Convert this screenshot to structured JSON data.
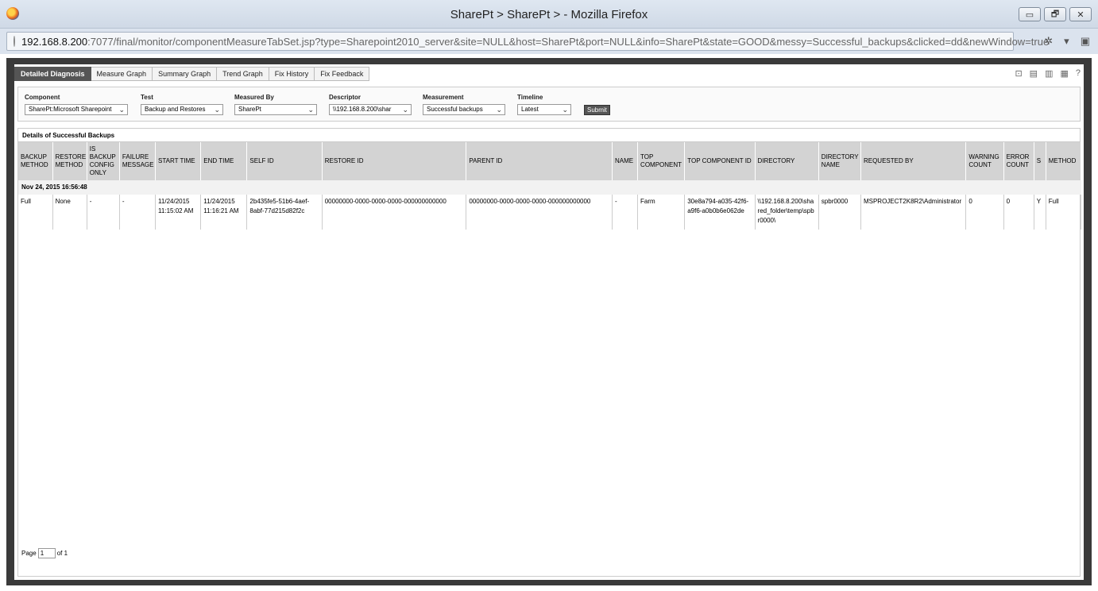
{
  "window": {
    "title": "SharePt > SharePt > - Mozilla Firefox",
    "btn_min": "▭",
    "btn_max": "🗗",
    "btn_close": "✕"
  },
  "url": {
    "host": "192.168.8.200",
    "path": ":7077/final/monitor/componentMeasureTabSet.jsp?type=Sharepoint2010_server&site=NULL&host=SharePt&port=NULL&info=SharePt&state=GOOD&messy=Successful_backups&clicked=dd&newWindow=true"
  },
  "tabs": [
    "Detailed Diagnosis",
    "Measure Graph",
    "Summary Graph",
    "Trend Graph",
    "Fix History",
    "Fix Feedback"
  ],
  "filters": {
    "component": {
      "label": "Component",
      "value": "SharePt:Microsoft Sharepoint"
    },
    "test": {
      "label": "Test",
      "value": "Backup and Restores"
    },
    "measured_by": {
      "label": "Measured By",
      "value": "SharePt"
    },
    "descriptor": {
      "label": "Descriptor",
      "value": "\\\\192.168.8.200\\shar"
    },
    "measurement": {
      "label": "Measurement",
      "value": "Successful backups"
    },
    "timeline": {
      "label": "Timeline",
      "value": "Latest"
    },
    "submit": "Submit"
  },
  "panel_title": "Details of Successful Backups",
  "columns": [
    "BACKUP METHOD",
    "RESTORE METHOD",
    "IS BACKUP CONFIG ONLY",
    "FAILURE MESSAGE",
    "START TIME",
    "END TIME",
    "SELF ID",
    "RESTORE ID",
    "PARENT ID",
    "NAME",
    "TOP COMPONENT",
    "TOP COMPONENT ID",
    "DIRECTORY",
    "DIRECTORY NAME",
    "REQUESTED BY",
    "WARNING COUNT",
    "ERROR COUNT",
    "S",
    "METHOD"
  ],
  "group_label": "Nov 24, 2015 16:56:48",
  "rows": [
    [
      "Full",
      "None",
      "-",
      "-",
      "11/24/2015 11:15:02 AM",
      "11/24/2015 11:16:21 AM",
      "2b435fe5-51b6-4aef-8abf-77d215d82f2c",
      "00000000-0000-0000-0000-000000000000",
      "00000000-0000-0000-0000-000000000000",
      "-",
      "Farm",
      "30e8a794-a035-42f6-a9f6-a0b0b6e062de",
      "\\\\192.168.8.200\\shared_folder\\temp\\spbr0000\\",
      "spbr0000",
      "MSPROJECT2K8R2\\Administrator",
      "0",
      "0",
      "Y",
      "Full"
    ]
  ],
  "pager": {
    "page_label": "Page",
    "page_value": "1",
    "of_label": "of 1"
  }
}
